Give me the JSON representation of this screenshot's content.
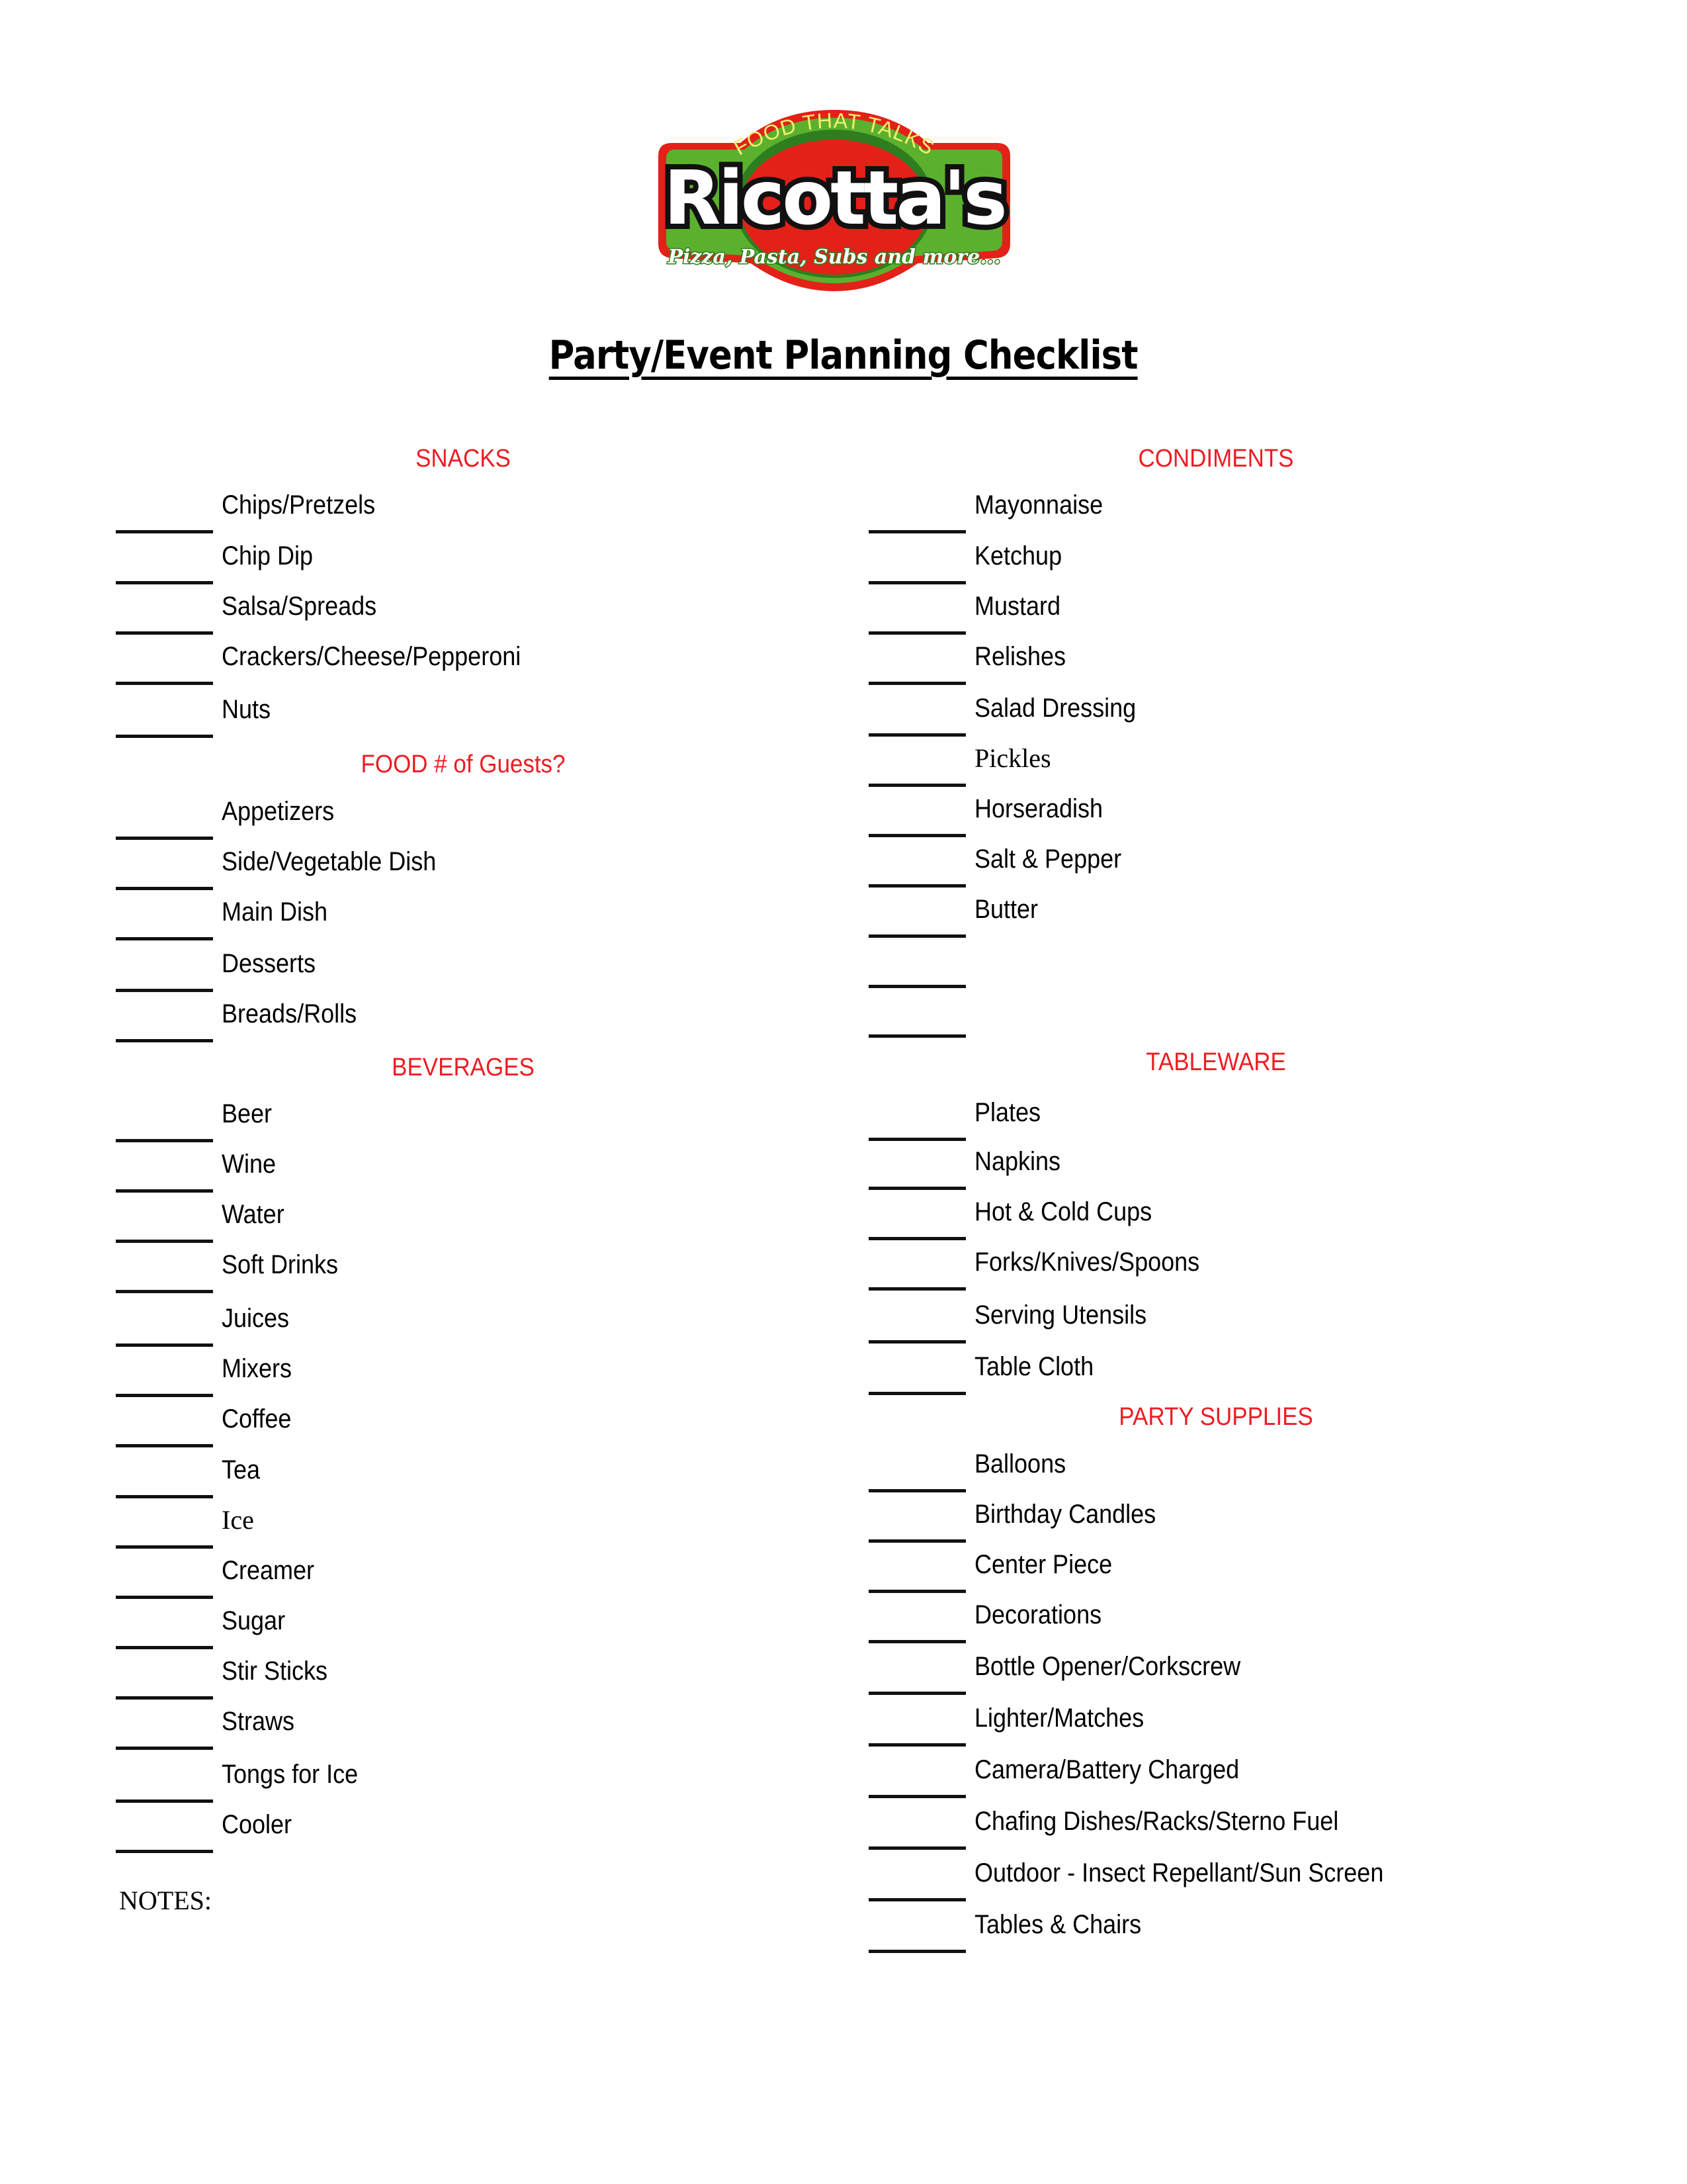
{
  "logo": {
    "tagline_top": "FOOD THAT TALKS",
    "brand": "Ricotta's",
    "tagline_bottom": "Pizza, Pasta, Subs and more...",
    "colors": {
      "red": "#E32119",
      "green": "#5BB12E",
      "dark_green": "#2E7D1F",
      "yellow": "#F3EF6E",
      "black": "#111111",
      "white": "#FFFFFF"
    }
  },
  "title": "Party/Event Planning Checklist",
  "accent_color": "#ED1C24",
  "left_column": {
    "sections": [
      {
        "heading": "SNACKS",
        "items": [
          "Chips/Pretzels",
          "Chip Dip",
          "Salsa/Spreads",
          "Crackers/Cheese/Pepperoni",
          "Nuts"
        ]
      },
      {
        "heading": "FOOD # of Guests?",
        "items": [
          "Appetizers",
          "Side/Vegetable Dish",
          "Main Dish",
          "Desserts",
          "Breads/Rolls"
        ]
      },
      {
        "heading": "BEVERAGES",
        "items": [
          "Beer",
          "Wine",
          "Water",
          "Soft Drinks",
          "Juices",
          "Mixers",
          "Coffee",
          "Tea",
          "Ice",
          "Creamer",
          "Sugar",
          "Stir Sticks",
          "Straws",
          "Tongs for Ice",
          "Cooler"
        ]
      }
    ],
    "notes_label": "NOTES:"
  },
  "right_column": {
    "sections": [
      {
        "heading": "CONDIMENTS",
        "items": [
          "Mayonnaise",
          "Ketchup",
          "Mustard",
          "Relishes",
          "Salad Dressing",
          "Pickles",
          "Horseradish",
          "Salt & Pepper",
          "Butter",
          "",
          ""
        ]
      },
      {
        "heading": "TABLEWARE",
        "items": [
          "Plates",
          "Napkins",
          "Hot & Cold Cups",
          "Forks/Knives/Spoons",
          "Serving Utensils",
          "Table Cloth"
        ]
      },
      {
        "heading": "PARTY SUPPLIES",
        "items": [
          "Balloons",
          "Birthday Candles",
          "Center Piece",
          "Decorations",
          "Bottle Opener/Corkscrew",
          "Lighter/Matches",
          "Camera/Battery Charged",
          "Chafing Dishes/Racks/Sterno Fuel",
          "Outdoor - Insect Repellant/Sun Screen",
          "Tables & Chairs"
        ]
      }
    ]
  }
}
